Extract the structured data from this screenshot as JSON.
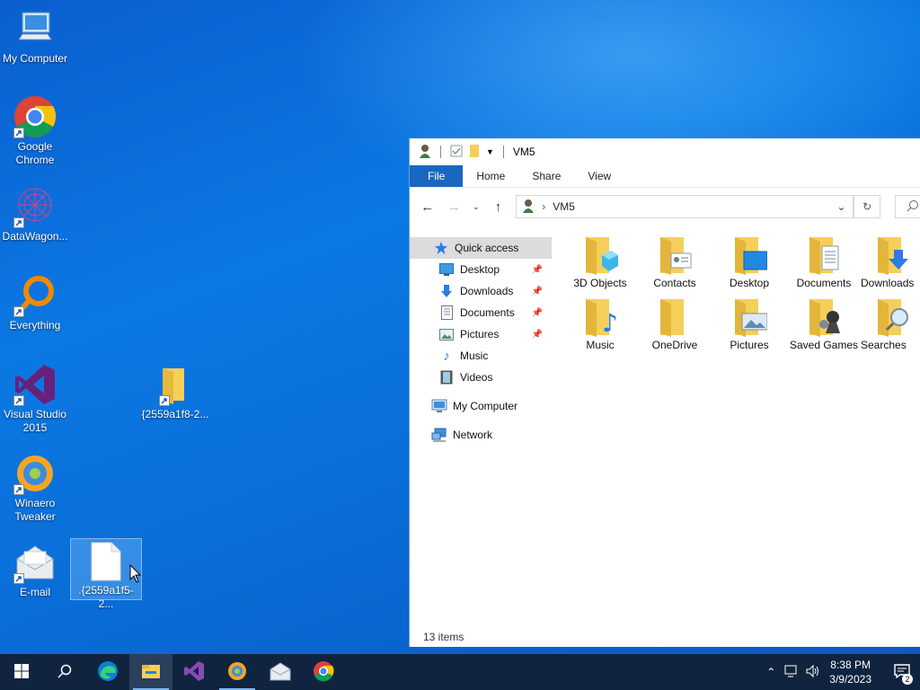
{
  "desktop": {
    "icons": [
      {
        "label": "My Computer"
      },
      {
        "label": "Google Chrome"
      },
      {
        "label": "DataWagon..."
      },
      {
        "label": "Everything"
      },
      {
        "label": "Visual Studio 2015"
      },
      {
        "label": "Winaero Tweaker"
      },
      {
        "label": "E-mail"
      },
      {
        "label": "{2559a1f8-2..."
      },
      {
        "label": ".{2559a1f5-2..."
      }
    ]
  },
  "explorer": {
    "title": "VM5",
    "ribbon": {
      "file": "File",
      "home": "Home",
      "share": "Share",
      "view": "View"
    },
    "address": {
      "path": "VM5"
    },
    "nav": {
      "quick_access": "Quick access",
      "items": [
        {
          "label": "Desktop"
        },
        {
          "label": "Downloads"
        },
        {
          "label": "Documents"
        },
        {
          "label": "Pictures"
        },
        {
          "label": "Music"
        },
        {
          "label": "Videos"
        }
      ],
      "my_computer": "My Computer",
      "network": "Network"
    },
    "folders": [
      {
        "label": "3D Objects"
      },
      {
        "label": "Contacts"
      },
      {
        "label": "Desktop"
      },
      {
        "label": "Documents"
      },
      {
        "label": "Downloads"
      },
      {
        "label": "Music"
      },
      {
        "label": "OneDrive"
      },
      {
        "label": "Pictures"
      },
      {
        "label": "Saved Games"
      },
      {
        "label": "Searches"
      }
    ],
    "status": "13 items"
  },
  "taskbar": {
    "time": "8:38 PM",
    "date": "3/9/2023",
    "notifications": "2"
  },
  "colors": {
    "accent": "#1a67c0",
    "folder": "#f5cf5a"
  }
}
